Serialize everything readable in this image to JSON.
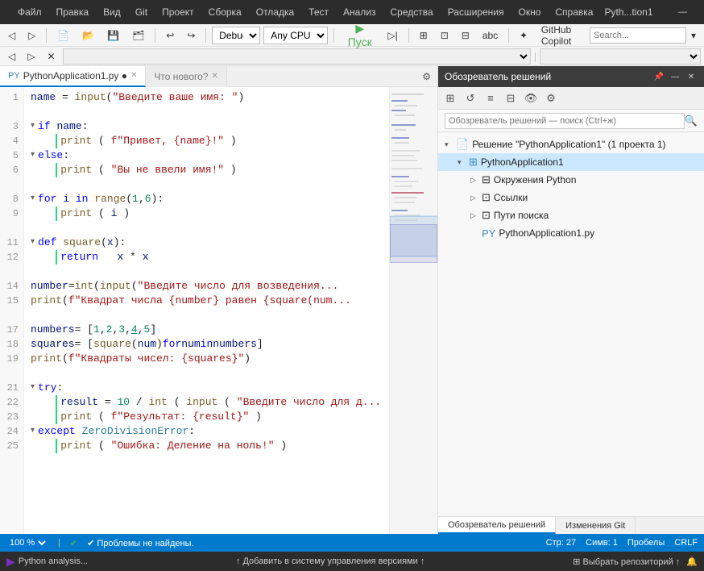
{
  "titleBar": {
    "appName": "Pyth...tion1",
    "menus": [
      "Файл",
      "Правка",
      "Вид",
      "Git",
      "Проект",
      "Сборка",
      "Отладка",
      "Тест",
      "Анализ",
      "Средства",
      "Расширения",
      "Окно",
      "Справка"
    ]
  },
  "toolbar": {
    "config": "Debug",
    "cpu": "Any CPU",
    "playLabel": "▶ Пуск",
    "githubCopilot": "GitHub Copilot"
  },
  "editorTabs": {
    "active": "PythonApplication1.py ●",
    "inactive": "Что нового?",
    "settings": "⚙"
  },
  "code": {
    "lines": [
      {
        "num": 1,
        "content": "name = input(\"Введите ваше имя: \")"
      },
      {
        "num": 2,
        "content": ""
      },
      {
        "num": 3,
        "content": "if name:"
      },
      {
        "num": 4,
        "content": "    print(f\"Привет, {name}!\")"
      },
      {
        "num": 5,
        "content": "else:"
      },
      {
        "num": 6,
        "content": "    print(\"Вы не ввели имя!\")"
      },
      {
        "num": 7,
        "content": ""
      },
      {
        "num": 8,
        "content": "for i in range(1, 6):"
      },
      {
        "num": 9,
        "content": "    print(i)"
      },
      {
        "num": 10,
        "content": ""
      },
      {
        "num": 11,
        "content": "def square(x):"
      },
      {
        "num": 12,
        "content": "    return x * x"
      },
      {
        "num": 13,
        "content": ""
      },
      {
        "num": 14,
        "content": "number = int(input(\"Введите число для возведения..."
      },
      {
        "num": 15,
        "content": "print(f\"Квадрат числа {number} равен {square(num..."
      },
      {
        "num": 16,
        "content": ""
      },
      {
        "num": 17,
        "content": "numbers = [1, 2, 3, 4, 5]"
      },
      {
        "num": 18,
        "content": "squares = [square(num) for num in numbers]"
      },
      {
        "num": 19,
        "content": "print(f\"Квадраты чисел: {squares}\")"
      },
      {
        "num": 20,
        "content": ""
      },
      {
        "num": 21,
        "content": "try:"
      },
      {
        "num": 22,
        "content": "    result = 10 / int(input(\"Введите число для д..."
      },
      {
        "num": 23,
        "content": "    print(f\"Результат: {result}\")"
      },
      {
        "num": 24,
        "content": "except ZeroDivisionError:"
      },
      {
        "num": 25,
        "content": "    print(\"Ошибка: Деление на ноль!\")"
      }
    ]
  },
  "solutionExplorer": {
    "title": "Обозреватель решений",
    "searchPlaceholder": "Обозреватель решений — поиск (Ctrl+ж)",
    "solutionName": "Решение \"PythonApplication1\" (1 проекта 1)",
    "projectName": "PythonApplication1",
    "items": [
      {
        "label": "Окружения Python",
        "indent": 2
      },
      {
        "label": "Ссылки",
        "indent": 2
      },
      {
        "label": "Пути поиска",
        "indent": 2
      },
      {
        "label": "PythonApplication1.py",
        "indent": 2
      }
    ],
    "bottomTabs": [
      "Обозреватель решений",
      "Изменения Git"
    ]
  },
  "statusBar": {
    "zoom": "100 %",
    "status": "✔ Проблемы не найдены.",
    "row": "Стр: 27",
    "col": "Симв: 1",
    "spaces": "Пробелы",
    "encoding": "CRLF"
  },
  "taskbar": {
    "left": "Python analysis...",
    "center": "↑ Добавить в систему управления версиями ↑",
    "right": "⊞ Выбрать репозиторий ↑",
    "bell": "🔔"
  }
}
